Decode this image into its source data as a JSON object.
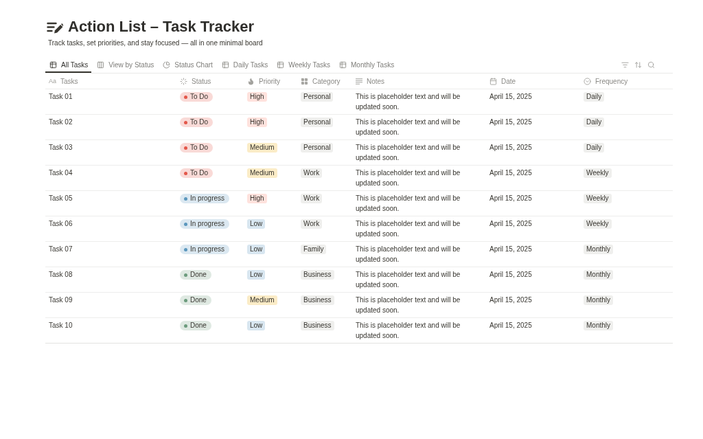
{
  "page": {
    "title": "Action List – Task Tracker",
    "subtitle": "Track tasks, set priorities, and stay focused — all in one minimal board"
  },
  "views": {
    "tabs": [
      {
        "label": "All Tasks",
        "kind": "table",
        "selected": true
      },
      {
        "label": "View by Status",
        "kind": "board",
        "selected": false
      },
      {
        "label": "Status Chart",
        "kind": "chart",
        "selected": false
      },
      {
        "label": "Daily Tasks",
        "kind": "table",
        "selected": false
      },
      {
        "label": "Weekly Tasks",
        "kind": "table",
        "selected": false
      },
      {
        "label": "Monthly Tasks",
        "kind": "table",
        "selected": false
      }
    ]
  },
  "table": {
    "columns": [
      {
        "label": "Tasks",
        "kind": "title",
        "glyph": "Aa"
      },
      {
        "label": "Status",
        "kind": "status"
      },
      {
        "label": "Priority",
        "kind": "priority"
      },
      {
        "label": "Category",
        "kind": "category"
      },
      {
        "label": "Notes",
        "kind": "text"
      },
      {
        "label": "Date",
        "kind": "date"
      },
      {
        "label": "Frequency",
        "kind": "frequency"
      }
    ],
    "rows": [
      {
        "task": "Task 01",
        "status": {
          "label": "To Do",
          "color": "#e3574a"
        },
        "priority": {
          "label": "High",
          "color": "#ffe2dd"
        },
        "category": "Personal",
        "notes": "This is placeholder text and will be updated soon.",
        "date": "April 15, 2025",
        "frequency": "Daily"
      },
      {
        "task": "Task 02",
        "status": {
          "label": "To Do",
          "color": "#e3574a"
        },
        "priority": {
          "label": "High",
          "color": "#ffe2dd"
        },
        "category": "Personal",
        "notes": "This is placeholder text and will be updated soon.",
        "date": "April 15, 2025",
        "frequency": "Daily"
      },
      {
        "task": "Task 03",
        "status": {
          "label": "To Do",
          "color": "#e3574a"
        },
        "priority": {
          "label": "Medium",
          "color": "#fbecc7"
        },
        "category": "Personal",
        "notes": "This is placeholder text and will be updated soon.",
        "date": "April 15, 2025",
        "frequency": "Daily"
      },
      {
        "task": "Task 04",
        "status": {
          "label": "To Do",
          "color": "#e3574a"
        },
        "priority": {
          "label": "Medium",
          "color": "#fbecc7"
        },
        "category": "Work",
        "notes": "This is placeholder text and will be updated soon.",
        "date": "April 15, 2025",
        "frequency": "Weekly"
      },
      {
        "task": "Task 05",
        "status": {
          "label": "In progress",
          "color": "#5b97bd"
        },
        "priority": {
          "label": "High",
          "color": "#ffe2dd"
        },
        "category": "Work",
        "notes": "This is placeholder text and will be updated soon.",
        "date": "April 15, 2025",
        "frequency": "Weekly"
      },
      {
        "task": "Task 06",
        "status": {
          "label": "In progress",
          "color": "#5b97bd"
        },
        "priority": {
          "label": "Low",
          "color": "#d8e6f0"
        },
        "category": "Work",
        "notes": "This is placeholder text and will be updated soon.",
        "date": "April 15, 2025",
        "frequency": "Weekly"
      },
      {
        "task": "Task 07",
        "status": {
          "label": "In progress",
          "color": "#5b97bd"
        },
        "priority": {
          "label": "Low",
          "color": "#d8e6f0"
        },
        "category": "Family",
        "notes": "This is placeholder text and will be updated soon.",
        "date": "April 15, 2025",
        "frequency": "Monthly"
      },
      {
        "task": "Task 08",
        "status": {
          "label": "Done",
          "color": "#6c9b7d"
        },
        "priority": {
          "label": "Low",
          "color": "#d8e6f0"
        },
        "category": "Business",
        "notes": "This is placeholder text and will be updated soon.",
        "date": "April 15, 2025",
        "frequency": "Monthly"
      },
      {
        "task": "Task 09",
        "status": {
          "label": "Done",
          "color": "#6c9b7d"
        },
        "priority": {
          "label": "Medium",
          "color": "#fbecc7"
        },
        "category": "Business",
        "notes": "This is placeholder text and will be updated soon.",
        "date": "April 15, 2025",
        "frequency": "Monthly"
      },
      {
        "task": "Task 10",
        "status": {
          "label": "Done",
          "color": "#6c9b7d"
        },
        "priority": {
          "label": "Low",
          "color": "#d8e6f0"
        },
        "category": "Business",
        "notes": "This is placeholder text and will be updated soon.",
        "date": "April 15, 2025",
        "frequency": "Monthly"
      }
    ]
  }
}
